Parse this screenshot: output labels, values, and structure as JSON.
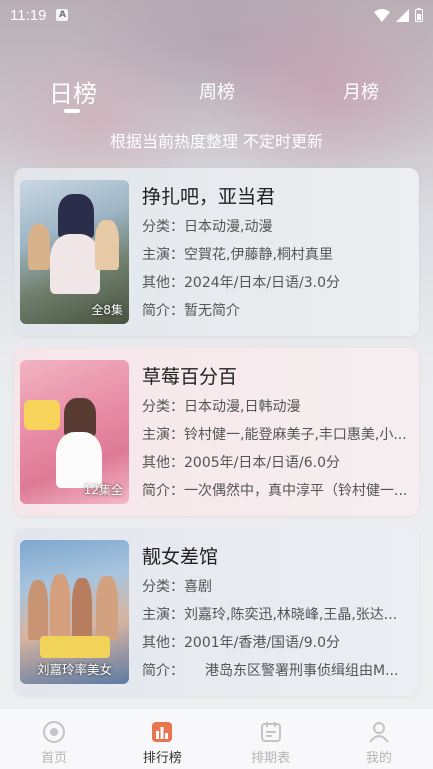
{
  "status_bar": {
    "time": "11:19",
    "notification_letter": "A"
  },
  "tabs": {
    "daily": "日榜",
    "weekly": "周榜",
    "monthly": "月榜"
  },
  "subtitle": "根据当前热度整理 不定时更新",
  "cards": [
    {
      "title": "挣扎吧，亚当君",
      "category": "分类：日本动漫,动漫",
      "cast": "主演：空賀花,伊藤静,桐村真里",
      "other": "其他：2024年/日本/日语/3.0分",
      "intro": "简介：暂无简介",
      "episodes": "全8集"
    },
    {
      "title": "草莓百分百",
      "category": "分类：日本动漫,日韩动漫",
      "cast": "主演：铃村健一,能登麻美子,丰口惠美,小...",
      "other": "其他：2005年/日本/日语/6.0分",
      "intro": "简介：一次偶然中，真中淳平（铃村健一...",
      "episodes": "12集全"
    },
    {
      "title": "靓女差馆",
      "category": "分类：喜剧",
      "cast": "主演：刘嘉玲,陈奕迅,林晓峰,王晶,张达...",
      "other": "其他：2001年/香港/国语/9.0分",
      "intro": "简介：　　港岛东区警署刑事侦缉组由M...",
      "episodes": "刘嘉玲率美女"
    }
  ],
  "bottom_nav": [
    {
      "label": "首页",
      "icon": "home-icon"
    },
    {
      "label": "排行榜",
      "icon": "ranking-icon"
    },
    {
      "label": "排期表",
      "icon": "schedule-icon"
    },
    {
      "label": "我的",
      "icon": "profile-icon"
    }
  ],
  "colors": {
    "active_nav": "#333333",
    "inactive_nav": "#b5b5b8",
    "ranking_accent": "#e8754f"
  }
}
